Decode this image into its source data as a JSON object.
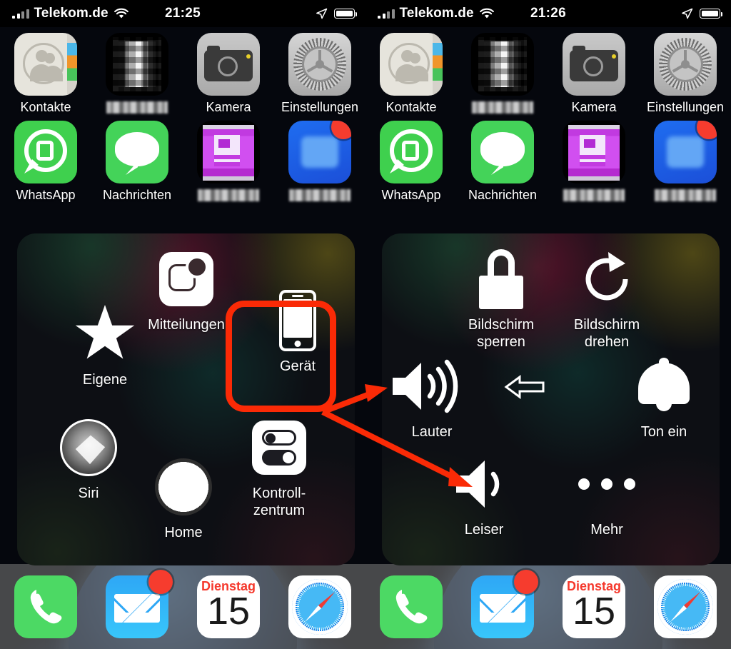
{
  "meta": {
    "description": "iOS AssistiveTouch menu side-by-side screenshot (German), device submenu highlighted",
    "accent_red": "#fa2a06"
  },
  "panes": [
    {
      "id": "left",
      "statusbar": {
        "carrier": "Telekom.de",
        "time": "21:25",
        "signal_icon": "signal-bars-icon",
        "wifi_icon": "wifi-icon",
        "location_icon": "location-arrow-icon",
        "battery_icon": "battery-icon"
      }
    },
    {
      "id": "right",
      "statusbar": {
        "carrier": "Telekom.de",
        "time": "21:26",
        "signal_icon": "signal-bars-icon",
        "wifi_icon": "wifi-icon",
        "location_icon": "location-arrow-icon",
        "battery_icon": "battery-icon"
      }
    }
  ],
  "homescreen": {
    "row1": [
      {
        "label": "Kontakte",
        "icon": "contacts-icon",
        "blurred": false,
        "badge": null
      },
      {
        "label": "",
        "icon": "blurred-app-icon",
        "blurred": true,
        "badge": null
      },
      {
        "label": "Kamera",
        "icon": "camera-icon",
        "blurred": false,
        "badge": null
      },
      {
        "label": "Einstellungen",
        "icon": "settings-gear-icon",
        "blurred": false,
        "badge": null
      }
    ],
    "row2": [
      {
        "label": "WhatsApp",
        "icon": "whatsapp-icon",
        "blurred": false,
        "badge": null
      },
      {
        "label": "Nachrichten",
        "icon": "messages-icon",
        "blurred": false,
        "badge": null
      },
      {
        "label": "",
        "icon": "blurred-app-icon",
        "blurred": true,
        "badge": null
      },
      {
        "label": "",
        "icon": "blurred-app-icon",
        "blurred": true,
        "badge": "badge"
      }
    ]
  },
  "dock": [
    {
      "label": "Telefon",
      "icon": "phone-icon",
      "badge": null
    },
    {
      "label": "Mail",
      "icon": "mail-icon",
      "badge": "badge"
    },
    {
      "label": "Kalender",
      "icon": "calendar-icon",
      "badge": null,
      "calendar": {
        "weekday": "Dienstag",
        "day": "15"
      }
    },
    {
      "label": "Safari",
      "icon": "safari-icon",
      "badge": null
    }
  ],
  "assistive_touch": {
    "main_menu": {
      "items": [
        {
          "label": "Mitteilungen",
          "icon": "notifications-icon"
        },
        {
          "label": "Gerät",
          "icon": "device-iphone-icon",
          "highlighted": true
        },
        {
          "label": "Eigene",
          "icon": "star-icon"
        },
        {
          "label": "Siri",
          "icon": "siri-icon"
        },
        {
          "label": "Home",
          "icon": "home-button-icon"
        },
        {
          "label": "Kontroll-\nzentrum",
          "label_line1": "Kontroll-",
          "label_line2": "zentrum",
          "icon": "control-center-icon"
        }
      ]
    },
    "device_menu": {
      "items": [
        {
          "label_line1": "Bildschirm",
          "label_line2": "sperren",
          "icon": "lock-icon"
        },
        {
          "label_line1": "Bildschirm",
          "label_line2": "drehen",
          "icon": "rotate-screen-icon"
        },
        {
          "label": "Lauter",
          "icon": "volume-up-icon"
        },
        {
          "label": "Ton ein",
          "icon": "bell-icon"
        },
        {
          "label": "Leiser",
          "icon": "volume-down-icon"
        },
        {
          "label": "Mehr",
          "icon": "more-dots-icon"
        },
        {
          "label": "",
          "icon": "back-arrow-icon"
        }
      ]
    }
  },
  "annotations": {
    "highlight_label": "Gerät",
    "arrows": [
      {
        "from": "geraet-highlight",
        "to": "Lauter"
      },
      {
        "from": "geraet-highlight",
        "to": "Leiser"
      }
    ]
  }
}
